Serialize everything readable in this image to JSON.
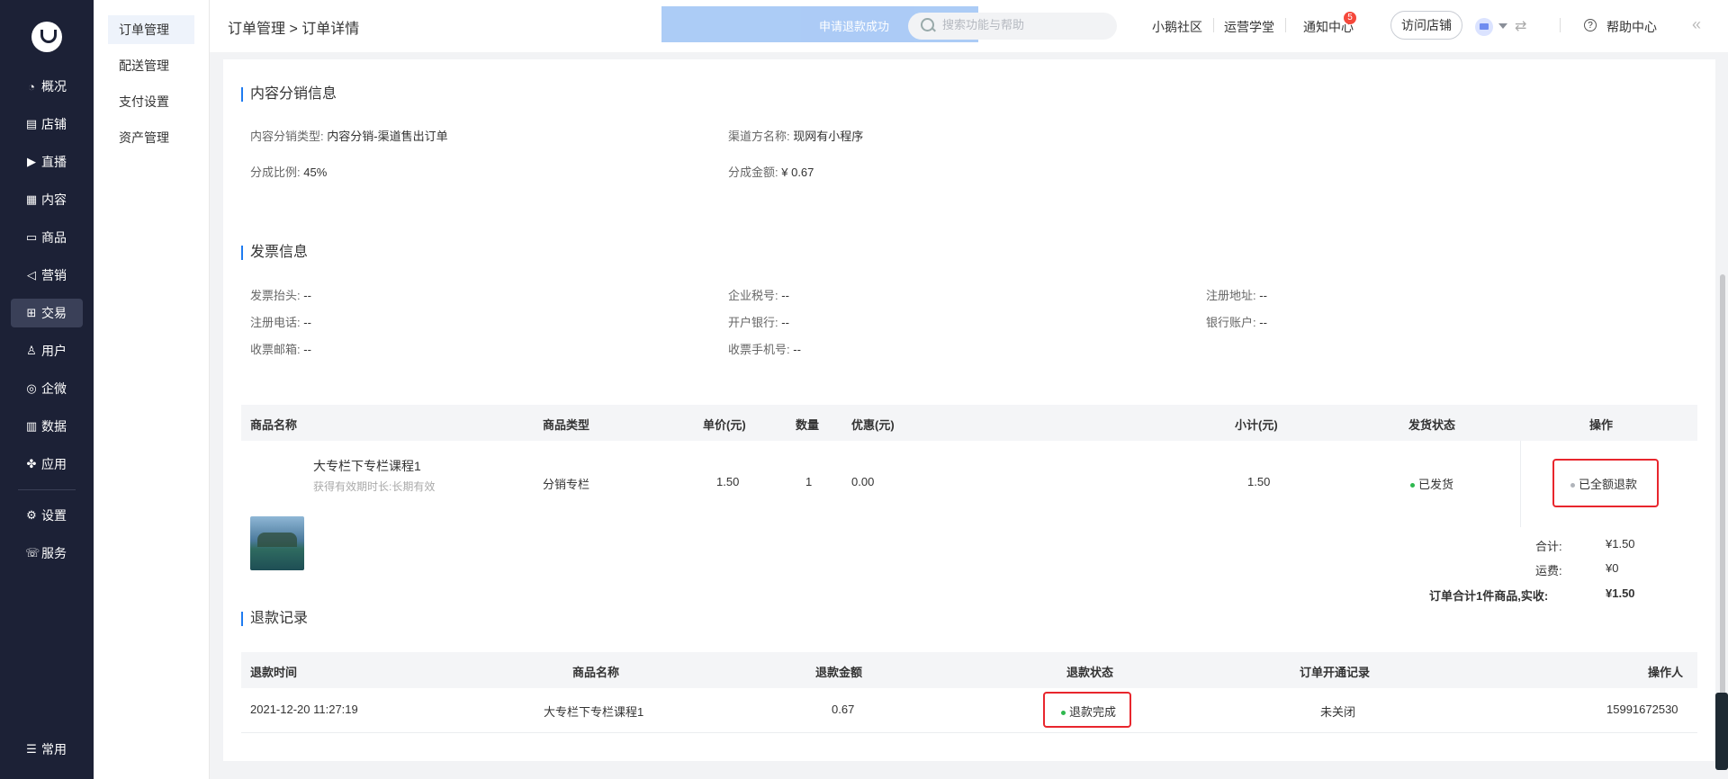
{
  "nav": {
    "items": [
      {
        "icon": "◔",
        "label": "概况",
        "iconName": "overview-icon"
      },
      {
        "icon": "▤",
        "label": "店铺",
        "iconName": "store-icon"
      },
      {
        "icon": "▶",
        "label": "直播",
        "iconName": "live-icon"
      },
      {
        "icon": "▦",
        "label": "内容",
        "iconName": "content-icon"
      },
      {
        "icon": "▭",
        "label": "商品",
        "iconName": "goods-icon"
      },
      {
        "icon": "◁",
        "label": "营销",
        "iconName": "marketing-icon"
      },
      {
        "icon": "⊞",
        "label": "交易",
        "iconName": "trade-icon"
      },
      {
        "icon": "♙",
        "label": "用户",
        "iconName": "user-icon"
      },
      {
        "icon": "◎",
        "label": "企微",
        "iconName": "wecom-icon"
      },
      {
        "icon": "▥",
        "label": "数据",
        "iconName": "data-icon"
      },
      {
        "icon": "✤",
        "label": "应用",
        "iconName": "apps-icon"
      }
    ],
    "bottom_items": [
      {
        "icon": "⚙",
        "label": "设置"
      },
      {
        "icon": "☏",
        "label": "服务"
      }
    ],
    "common": {
      "icon": "☰",
      "label": "常用"
    }
  },
  "subnav": {
    "items": [
      "订单管理",
      "配送管理",
      "支付设置",
      "资产管理"
    ]
  },
  "header": {
    "breadcrumb": "订单管理 > 订单详情",
    "toast": "申请退款成功",
    "search_placeholder": "搜索功能与帮助",
    "links": [
      "小鹅社区",
      "运营学堂",
      "通知中心"
    ],
    "notify_count": "5",
    "visit_store": "访问店铺",
    "help": "帮助中心"
  },
  "distribution": {
    "title": "内容分销信息",
    "type_label": "内容分销类型:",
    "type_value": "内容分销-渠道售出订单",
    "channel_label": "渠道方名称:",
    "channel_value": "现网有小程序",
    "ratio_label": "分成比例:",
    "ratio_value": "45%",
    "amount_label": "分成金额:",
    "amount_value": "¥ 0.67"
  },
  "invoice": {
    "title": "发票信息",
    "fields": [
      {
        "label": "发票抬头:",
        "value": "--"
      },
      {
        "label": "企业税号:",
        "value": "--"
      },
      {
        "label": "注册地址:",
        "value": "--"
      },
      {
        "label": "注册电话:",
        "value": "--"
      },
      {
        "label": "开户银行:",
        "value": "--"
      },
      {
        "label": "银行账户:",
        "value": "--"
      },
      {
        "label": "收票邮箱:",
        "value": "--"
      },
      {
        "label": "收票手机号:",
        "value": "--"
      }
    ]
  },
  "goods_table": {
    "headers": [
      "商品名称",
      "商品类型",
      "单价(元)",
      "数量",
      "优惠(元)",
      "小计(元)",
      "发货状态",
      "操作"
    ],
    "row": {
      "name": "大专栏下专栏课程1",
      "validity": "获得有效期时长:长期有效",
      "type": "分销专栏",
      "price": "1.50",
      "qty": "1",
      "discount": "0.00",
      "subtotal": "1.50",
      "ship_status": "已发货",
      "action": "已全额退款",
      "ship_color": "#2fb84f",
      "action_color": "#b0b4ba"
    },
    "summary": {
      "total_label": "合计:",
      "total_value": "¥1.50",
      "freight_label": "运费:",
      "freight_value": "¥0",
      "paid_label": "订单合计1件商品,实收:",
      "paid_value": "¥1.50"
    }
  },
  "refund": {
    "title": "退款记录",
    "headers": [
      "退款时间",
      "商品名称",
      "退款金额",
      "退款状态",
      "订单开通记录",
      "操作人"
    ],
    "row": {
      "time": "2021-12-20 11:27:19",
      "name": "大专栏下专栏课程1",
      "amount": "0.67",
      "status": "退款完成",
      "status_color": "#2fb84f",
      "open_record": "未关闭",
      "operator": "15991672530"
    }
  }
}
